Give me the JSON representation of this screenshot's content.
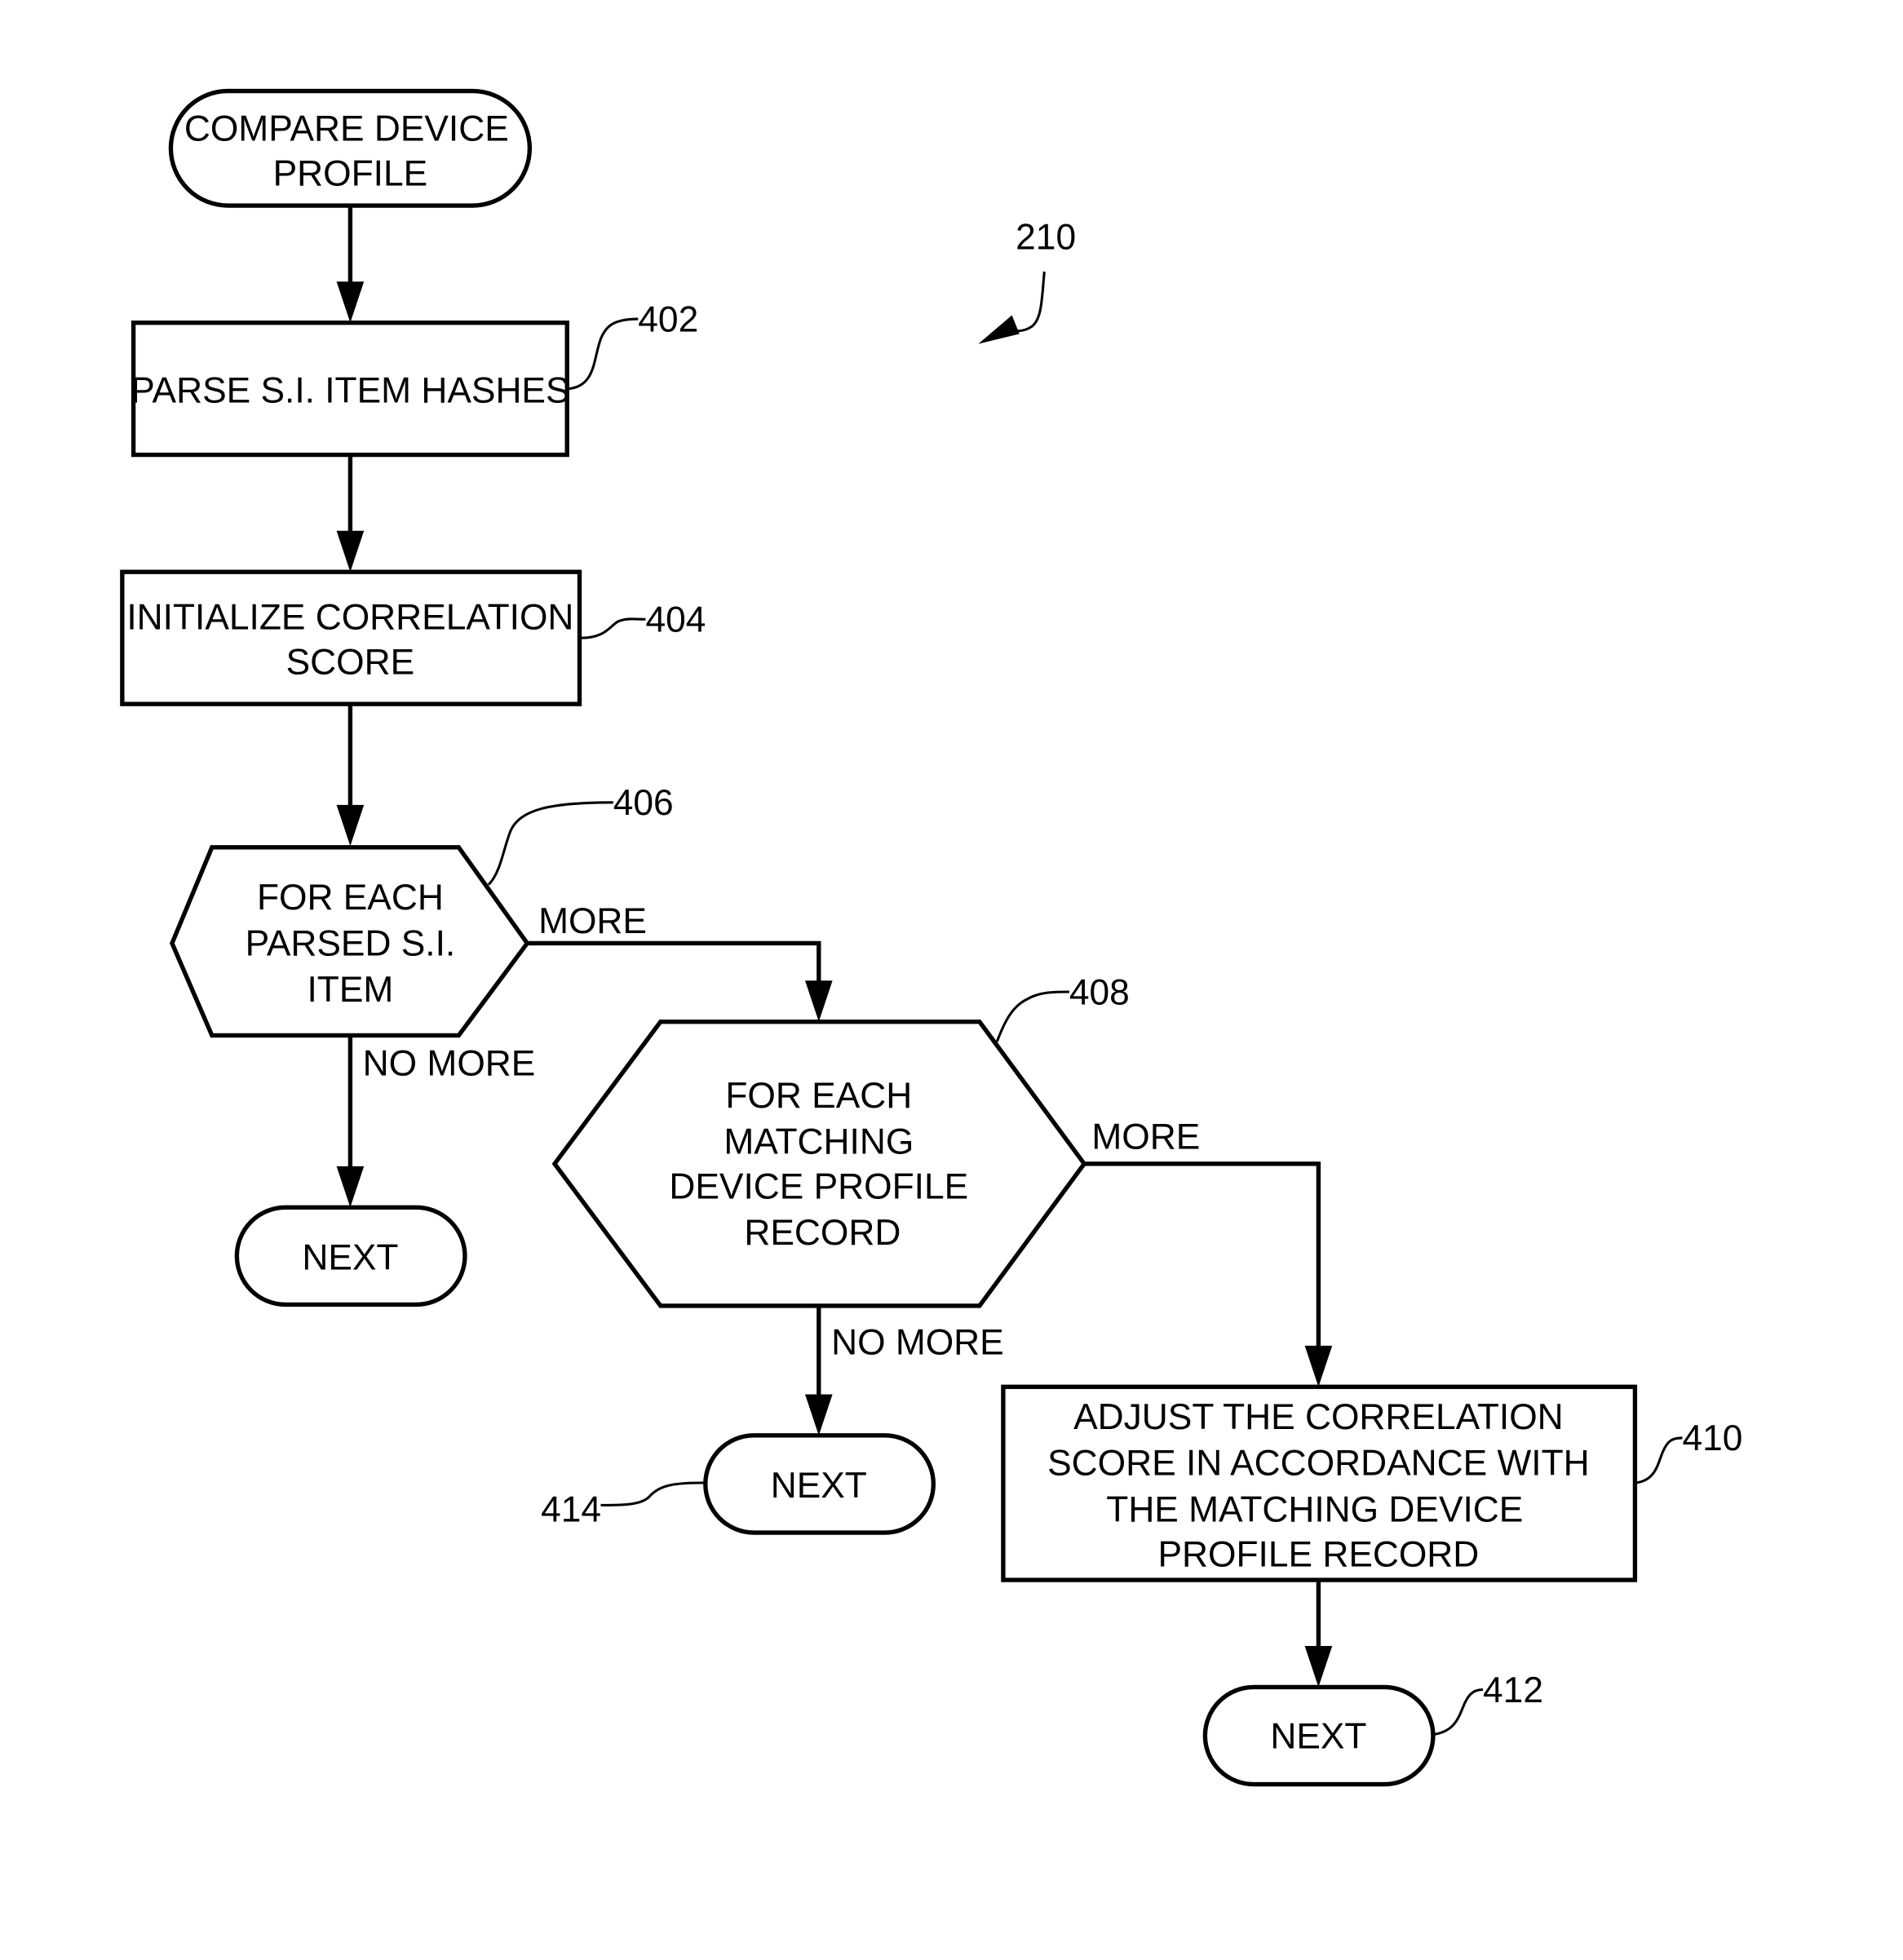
{
  "figure": {
    "reference": "210",
    "nodes": {
      "start": {
        "type": "terminator",
        "lines": [
          "COMPARE DEVICE",
          "PROFILE"
        ]
      },
      "n402": {
        "ref": "402",
        "type": "process",
        "lines": [
          "PARSE S.I. ITEM HASHES"
        ]
      },
      "n404": {
        "ref": "404",
        "type": "process",
        "lines": [
          "INITIALIZE CORRELATION",
          "SCORE"
        ]
      },
      "n406": {
        "ref": "406",
        "type": "loop",
        "lines": [
          "FOR EACH",
          "PARSED S.I.",
          "ITEM"
        ]
      },
      "next1": {
        "type": "terminator",
        "lines": [
          "NEXT"
        ]
      },
      "n408": {
        "ref": "408",
        "type": "loop",
        "lines": [
          "FOR EACH",
          "MATCHING",
          "DEVICE PROFILE",
          "RECORD"
        ]
      },
      "n414": {
        "ref": "414",
        "type": "terminator",
        "lines": [
          "NEXT"
        ]
      },
      "n410": {
        "ref": "410",
        "type": "process",
        "lines": [
          "ADJUST THE CORRELATION",
          "SCORE IN ACCORDANCE WITH",
          "THE MATCHING DEVICE",
          "PROFILE RECORD"
        ]
      },
      "n412": {
        "ref": "412",
        "type": "terminator",
        "lines": [
          "NEXT"
        ]
      }
    },
    "edges": {
      "e406_more": "MORE",
      "e406_nomore": "NO MORE",
      "e408_more": "MORE",
      "e408_nomore": "NO MORE"
    }
  }
}
